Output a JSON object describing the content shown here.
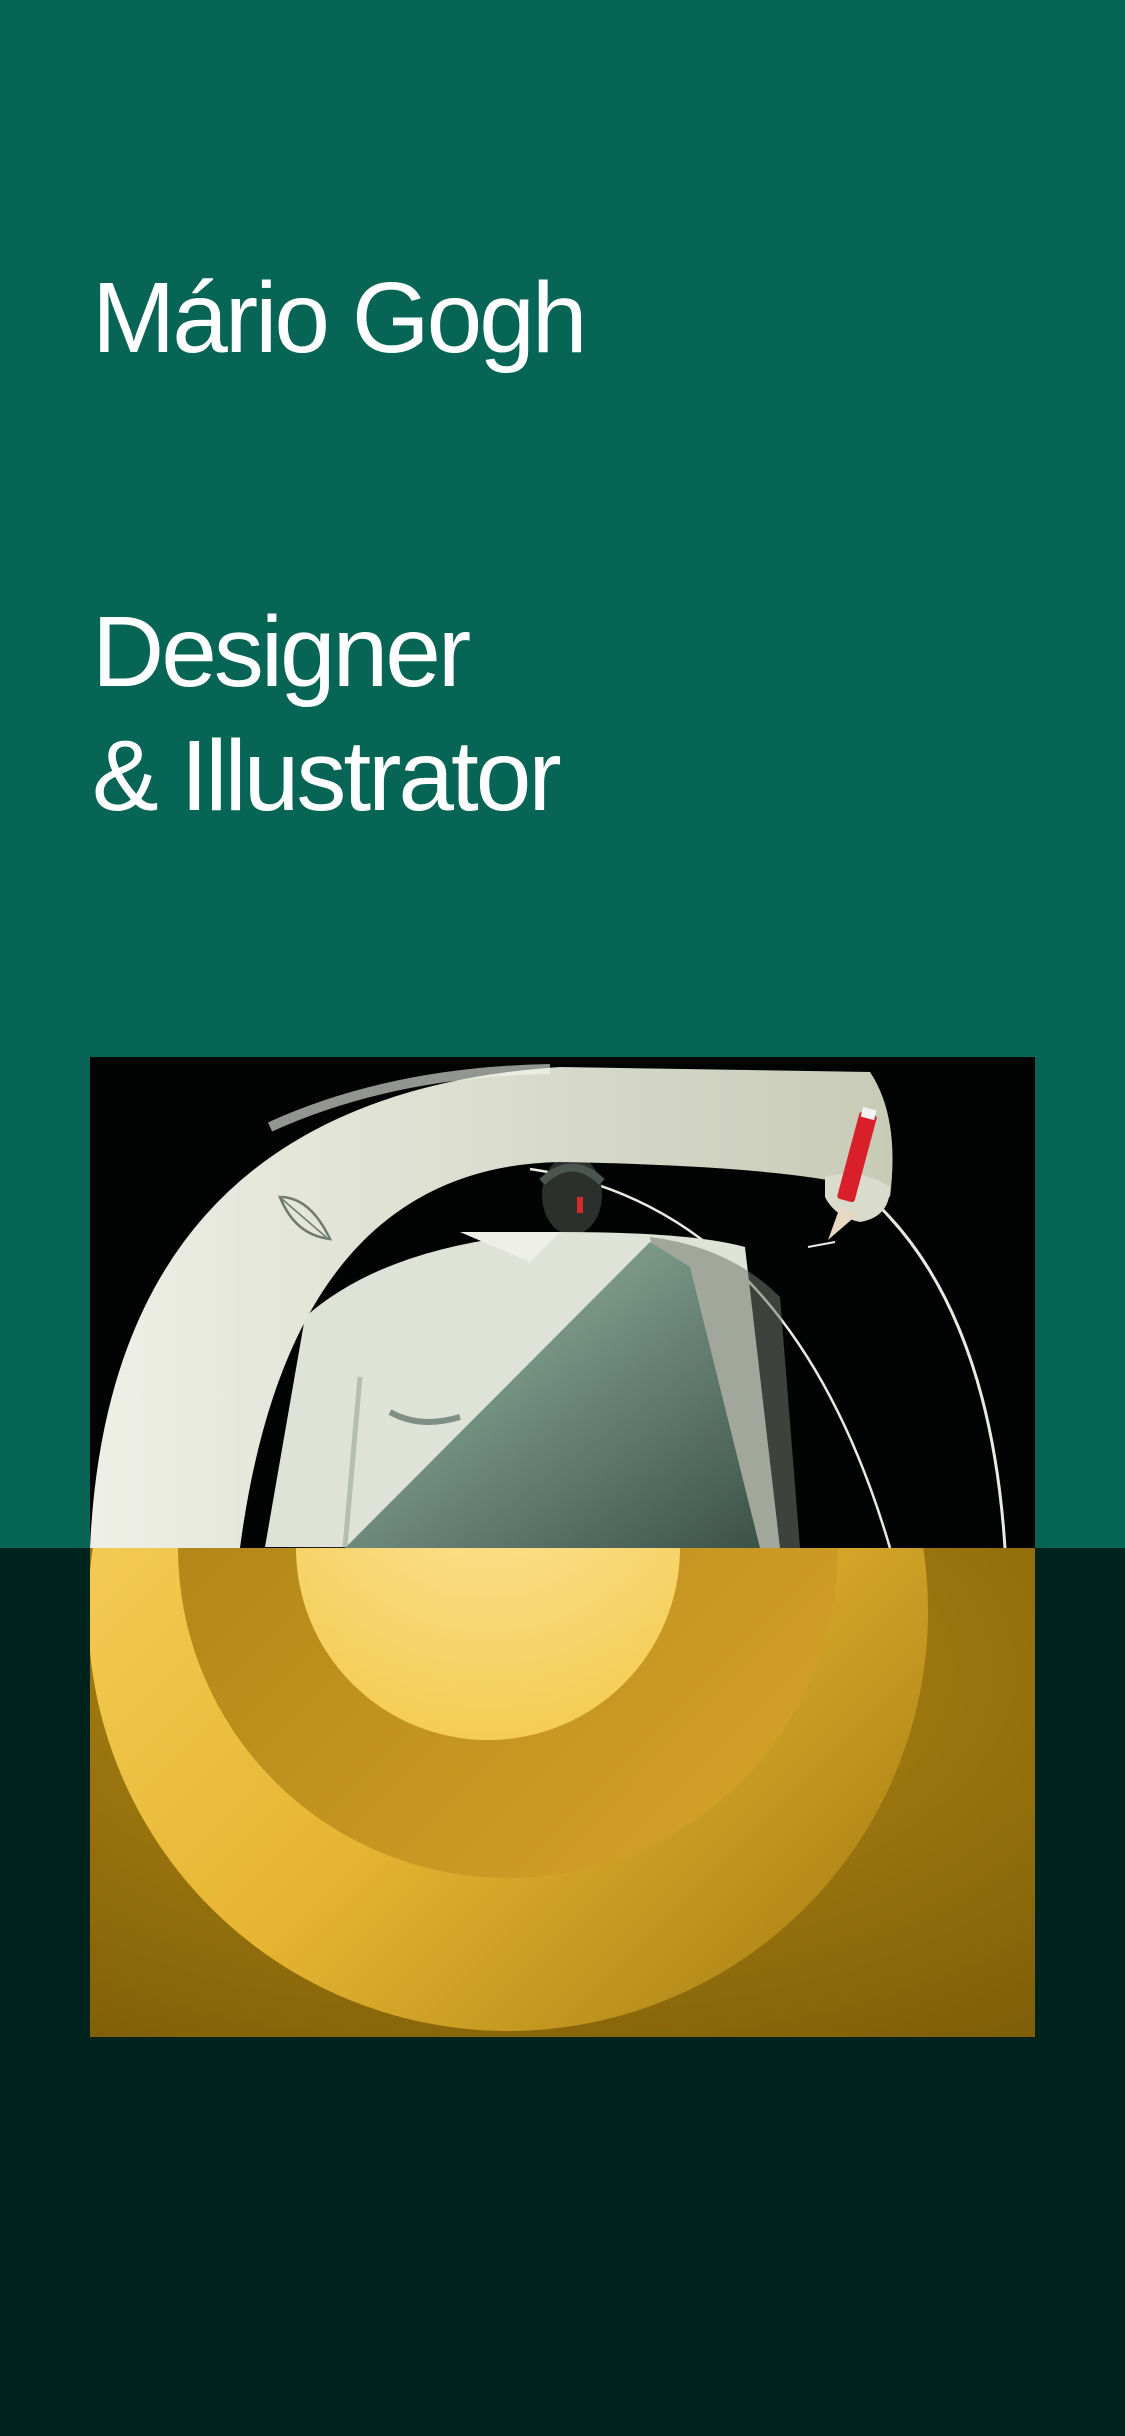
{
  "profile": {
    "name": "Mário Gogh",
    "role_line1": "Designer",
    "role_line2": "& Illustrator"
  },
  "artwork": {
    "subject": "figure in a toga drawing concentric arcs with a red pencil above golden rings",
    "icons": [
      "red-pencil-icon",
      "leaf-icon"
    ]
  },
  "colors": {
    "primary_green": "#066554",
    "dark_green": "#00241d",
    "gold": "#f5c94e",
    "dark_gold": "#8b6a0a",
    "pale_sage": "#dcdfd2",
    "sage_green": "#8fb3a1",
    "pencil_red": "#d91f2a",
    "text": "#ffffff"
  }
}
